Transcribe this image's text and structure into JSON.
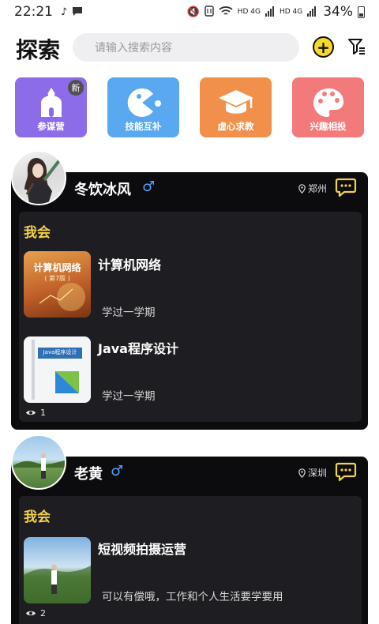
{
  "status_bar": {
    "time": "22:21",
    "battery": "34%",
    "signal_1": "HD 4G",
    "signal_2": "HD 4G"
  },
  "header": {
    "title": "探索",
    "search_placeholder": "请输入搜索内容"
  },
  "categories": [
    {
      "label": "参谋营",
      "icon": "building-icon",
      "color": "#8c6ce8",
      "badge": "新"
    },
    {
      "label": "技能互补",
      "icon": "pacman-icon",
      "color": "#5aa8f0"
    },
    {
      "label": "虚心求教",
      "icon": "grad-cap-icon",
      "color": "#f0904a"
    },
    {
      "label": "兴趣相投",
      "icon": "palette-icon",
      "color": "#f27a7a"
    }
  ],
  "colors": {
    "accent_yellow": "#f2d24b",
    "card_bg": "#0c0c0e",
    "inner_bg": "#1e1e22",
    "gender_male": "#4ea0ff"
  },
  "cards": [
    {
      "name": "冬饮冰风",
      "gender": "♂",
      "location": "郑州",
      "section_label": "我会",
      "skills": [
        {
          "title": "计算机网络",
          "desc": "学过一学期",
          "cover_title": "计算机网络",
          "cover_edition": "( 第7版 )"
        },
        {
          "title": "Java程序设计",
          "desc": "学过一学期",
          "cover_title": "Java程序设计"
        }
      ],
      "views": "1"
    },
    {
      "name": "老黄",
      "gender": "♂",
      "location": "深圳",
      "section_label": "我会",
      "skills": [
        {
          "title": "短视频拍摄运营",
          "desc": "可以有偿哦，工作和个人生活要学要用"
        }
      ],
      "views": "2"
    }
  ]
}
